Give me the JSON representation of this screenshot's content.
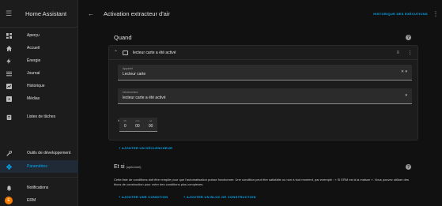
{
  "sidebar": {
    "title": "Home Assistant",
    "items": [
      {
        "label": "Aperçu",
        "icon": "dashboard-icon"
      },
      {
        "label": "Accueil",
        "icon": "home-icon"
      },
      {
        "label": "Énergie",
        "icon": "lightning-icon"
      },
      {
        "label": "Journal",
        "icon": "list-icon"
      },
      {
        "label": "Historique",
        "icon": "chart-icon"
      },
      {
        "label": "Médias",
        "icon": "media-icon"
      },
      {
        "label": "Listes de tâches",
        "icon": "clipboard-icon"
      }
    ],
    "bottom": [
      {
        "label": "Outils de développement",
        "icon": "wrench-icon"
      },
      {
        "label": "Paramètres",
        "icon": "gear-icon"
      },
      {
        "label": "Notifications",
        "icon": "bell-icon"
      },
      {
        "label": "ERM",
        "icon": "avatar",
        "initial": "E"
      }
    ]
  },
  "topbar": {
    "title": "Activation extracteur d'air",
    "history_button": "HISTORIQUE DES EXÉCUTIONS"
  },
  "quand": {
    "title": "Quand",
    "trigger": {
      "title": "lecteur carte a été activé",
      "device_label": "Appareil",
      "device_value": "Lecteur carte",
      "trigger_label": "Déclencheur",
      "trigger_value": "lecteur carte a été activé",
      "for_label": "for",
      "duration": [
        {
          "unit": "hh",
          "value": "0"
        },
        {
          "unit": "mm",
          "value": "00"
        },
        {
          "unit": "ss",
          "value": "00"
        }
      ]
    },
    "add_trigger": "+ AJOUTER UN DÉCLENCHEUR"
  },
  "etsi": {
    "title": "Et si",
    "optional": "(optionnel)",
    "description": "Cette liste de conditions doit être remplie pour que l'automatisation puisse fonctionner. Une condition peut être satisfaite ou non à tout moment, par exemple : « Si ERM est à la maison ». Vous pouvez utiliser des blocs de construction pour créer des conditions plus complexes.",
    "add_condition": "+ AJOUTER UNE CONDITION",
    "add_block": "+ AJOUTER UN BLOC DE CONSTRUCTION"
  },
  "colors": {
    "accent": "#03a9f4",
    "avatar": "#f57c00"
  }
}
